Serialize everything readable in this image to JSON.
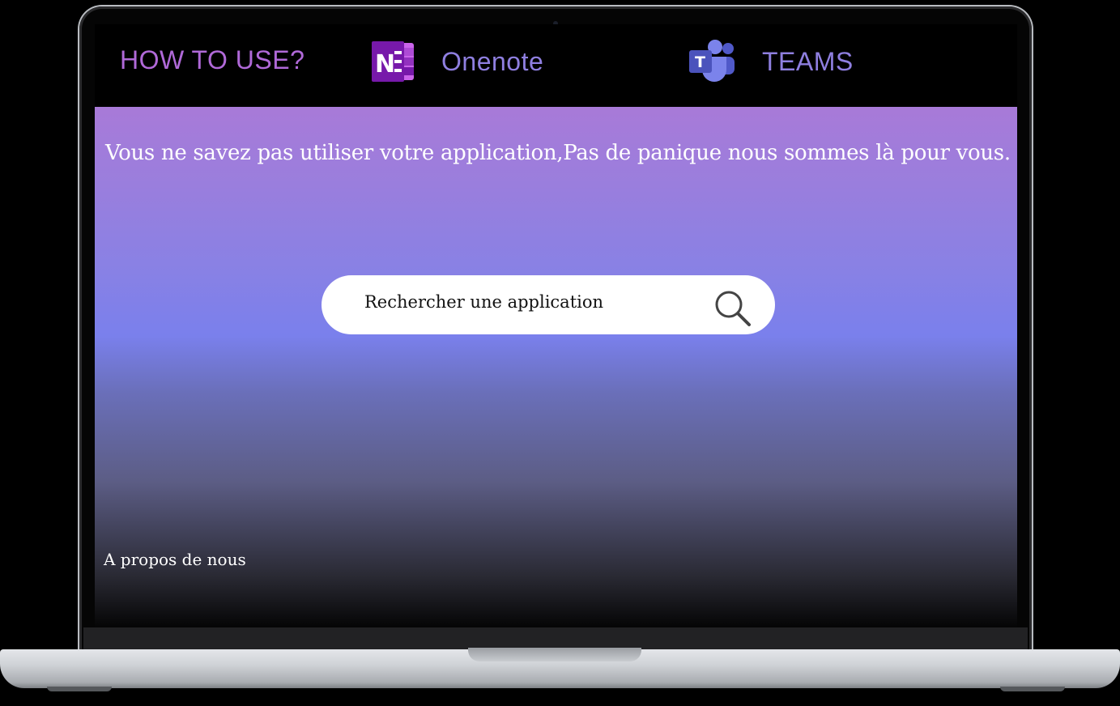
{
  "nav": {
    "brand": "HOW TO USE?",
    "items": [
      {
        "label": "Onenote",
        "icon": "onenote-icon",
        "color": "#7719aa"
      },
      {
        "label": "TEAMS",
        "icon": "teams-icon",
        "color": "#5059c9"
      }
    ]
  },
  "hero": {
    "tagline": "Vous ne savez pas utiliser votre application,Pas de panique nous sommes là pour vous.",
    "search": {
      "placeholder": "Rechercher une application",
      "icon": "search-icon"
    },
    "footer_link": "A propos de nous"
  },
  "colors": {
    "brand": "#b069d8",
    "nav_text": "#8f7fe0",
    "gradient_top": "#a87ad8",
    "gradient_mid": "#7a80ec",
    "gradient_bottom": "#050505"
  }
}
